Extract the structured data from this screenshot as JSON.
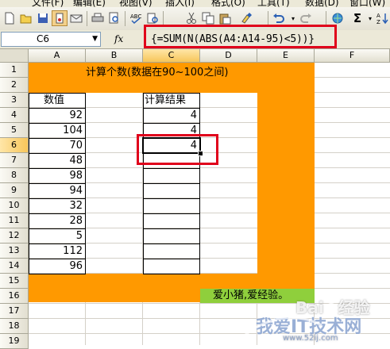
{
  "menubar": {
    "items": [
      "文件(F)",
      "编辑(E)",
      "视图(V)",
      "插入(I)",
      "格式(O)",
      "工具(T)",
      "数据(D)",
      "窗口(W)"
    ]
  },
  "toolbar": {
    "icons": [
      "new-icon",
      "open-icon",
      "save-icon",
      "permission-icon",
      "print-icon",
      "print-preview-icon",
      "spelling-icon",
      "research-icon",
      "cut-icon",
      "copy-icon",
      "paste-icon",
      "format-painter-icon",
      "undo-icon",
      "redo-icon",
      "hyperlink-icon",
      "autosum-icon",
      "sort-icon"
    ]
  },
  "formulabar": {
    "name_box": "C6",
    "fx_label": "fx",
    "formula": "{=SUM(N(ABS(A4:A14-95)<5))}"
  },
  "columns": [
    "A",
    "B",
    "C",
    "D",
    "E",
    "F"
  ],
  "rows": [
    "1",
    "2",
    "3",
    "4",
    "5",
    "6",
    "7",
    "8",
    "9",
    "10",
    "11",
    "12",
    "13",
    "14",
    "15",
    "16",
    "17",
    "18",
    "19"
  ],
  "sheet": {
    "title": "计算个数(数据在90~100之间)",
    "a_header": "数值",
    "c_header": "计算结果",
    "values": [
      "92",
      "104",
      "70",
      "48",
      "98",
      "94",
      "32",
      "28",
      "5",
      "112",
      "96"
    ],
    "results": [
      "4",
      "4",
      "4"
    ],
    "slogan": "爱小猪,爱经验。"
  },
  "watermark": {
    "brand": "Bai",
    "brand2": "经验",
    "site": "我爱IT技术网",
    "url": "www.52ij.com"
  },
  "colors": {
    "orange": "#ff9900",
    "green": "#8fcf3c",
    "highlight_red": "#e0001b"
  }
}
